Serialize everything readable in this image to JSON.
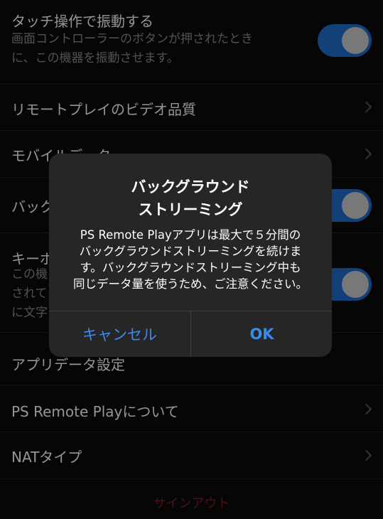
{
  "settings": {
    "vibrate": {
      "title": "タッチ操作で振動する",
      "desc_lines": [
        "画面コントローラーのボタンが押されたとき",
        "に、この機器を振動させます。"
      ],
      "enabled": true
    },
    "video_quality": {
      "label": "リモートプレイのビデオ品質"
    },
    "mobile_data": {
      "label": "モバイルデータ"
    },
    "background": {
      "label": "バックグラウンド",
      "enabled": true
    },
    "keyboard": {
      "title": "キーボード",
      "desc_lines": [
        "この機",
        "されて",
        "に文字"
      ],
      "enabled": true
    },
    "app_data": {
      "label": "アプリデータ設定"
    },
    "about": {
      "label": "PS Remote Playについて"
    },
    "nat": {
      "label": "NATタイプ"
    },
    "signout": "サインアウト"
  },
  "alert": {
    "title_lines": [
      "バックグラウンド",
      "ストリーミング"
    ],
    "message_lines": [
      "PS Remote Playアプリは最大で５分間の",
      "バックグラウンドストリーミングを続けま",
      "す。バックグラウンドストリーミング中も",
      "同じデータ量を使うため、ご注意ください。"
    ],
    "cancel_label": "キャンセル",
    "ok_label": "OK"
  },
  "colors": {
    "background": "#0b0b0b",
    "toggle_on": "#1f6fd1",
    "alert_button": "#3b8beb",
    "signout": "#8b1a1a",
    "secondary_text": "#8e8e93"
  },
  "icons": {
    "disclosure": "chevron-right-icon"
  }
}
